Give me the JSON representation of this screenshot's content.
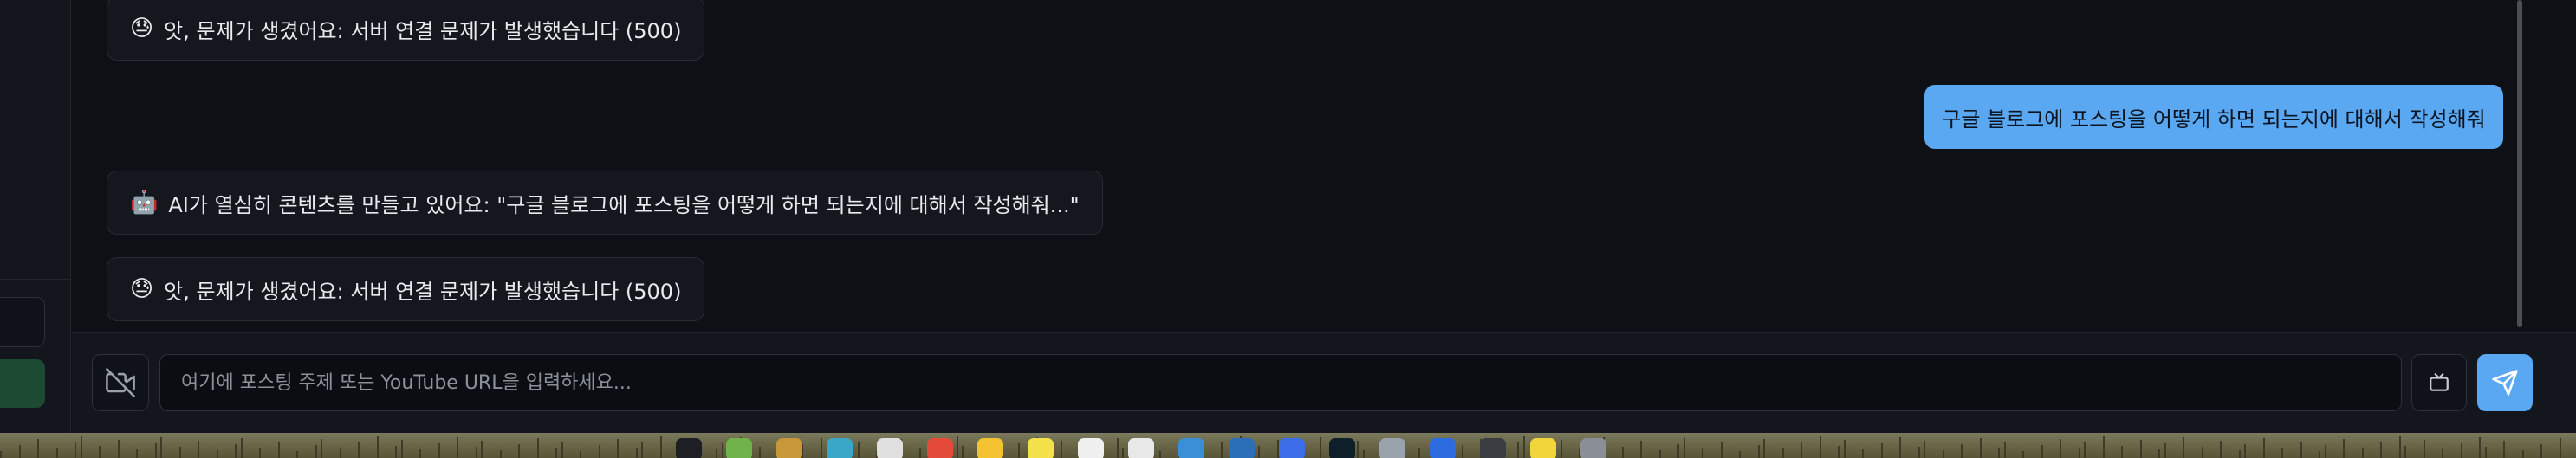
{
  "messages": [
    {
      "role": "bot",
      "emoji": "😓",
      "text": "앗, 문제가 생겼어요: 서버 연결 문제가 발생했습니다 (500)"
    },
    {
      "role": "user",
      "text": "구글 블로그에 포스팅을 어떻게 하면 되는지에 대해서 작성해줘"
    },
    {
      "role": "bot",
      "emoji": "🤖",
      "text": "AI가 열심히 콘텐츠를 만들고 있어요: \"구글 블로그에 포스팅을 어떻게 하면 되는지에 대해서 작성해줘...\""
    },
    {
      "role": "bot",
      "emoji": "😓",
      "text": "앗, 문제가 생겼어요: 서버 연결 문제가 발생했습니다 (500)"
    }
  ],
  "input": {
    "placeholder": "여기에 포스팅 주제 또는 YouTube URL을 입력하세요..."
  },
  "icons": {
    "left_toggle": "video-off-icon",
    "right_tool": "tv-icon",
    "send": "send-icon"
  },
  "colors": {
    "background": "#0e1016",
    "bubble_bot": "#14171d",
    "bubble_user": "#5aa7f2",
    "send_button": "#5aa7f2",
    "sidebar_button": "#1c4a33"
  }
}
